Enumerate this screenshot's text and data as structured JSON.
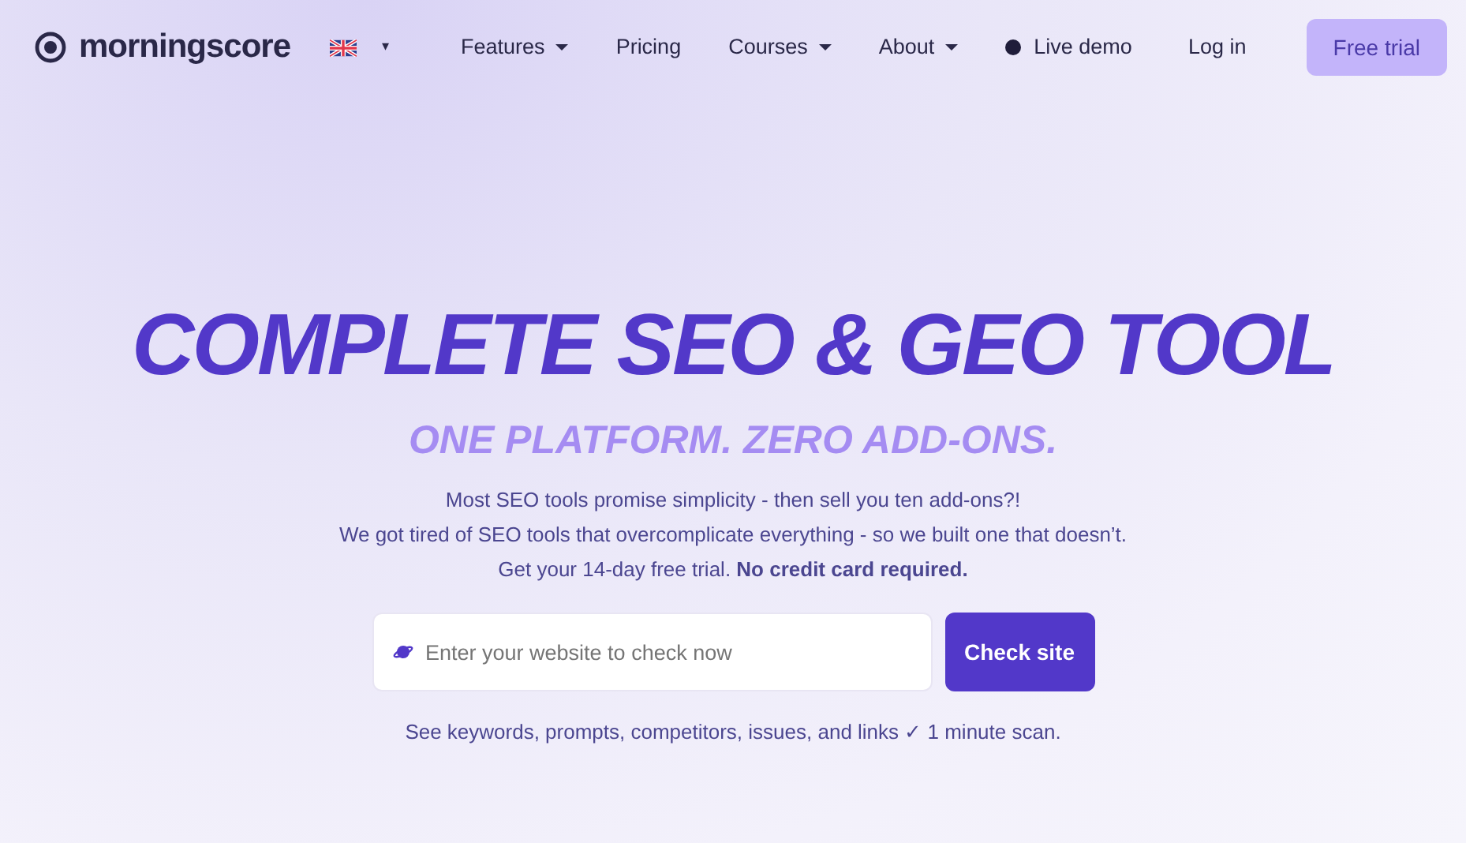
{
  "brand": {
    "name": "morningscore"
  },
  "language": {
    "caret": "▾"
  },
  "nav": [
    {
      "label": "Features",
      "dropdown": true
    },
    {
      "label": "Pricing",
      "dropdown": false
    },
    {
      "label": "Courses",
      "dropdown": true
    },
    {
      "label": "About",
      "dropdown": true
    },
    {
      "label": "Live demo",
      "dropdown": false,
      "kind": "live"
    }
  ],
  "actions": [
    {
      "label": "Log in",
      "kind": "link"
    },
    {
      "label": "Free trial",
      "kind": "primary"
    }
  ],
  "hero": {
    "title": "COMPLETE SEO & GEO TOOL",
    "subtitle": "ONE PLATFORM. ZERO ADD-ONS.",
    "lines": [
      "Most SEO tools promise simplicity - then sell you ten add-ons?!",
      "We got tired of SEO tools that overcomplicate everything - so we built one that doesn’t.",
      "Get your 14-day free trial. **No credit card required.**"
    ],
    "search": {
      "placeholder": "Enter your website to check now",
      "button": "Check site"
    },
    "note": "See keywords, prompts, competitors, issues, and links ✓ 1 minute scan."
  }
}
